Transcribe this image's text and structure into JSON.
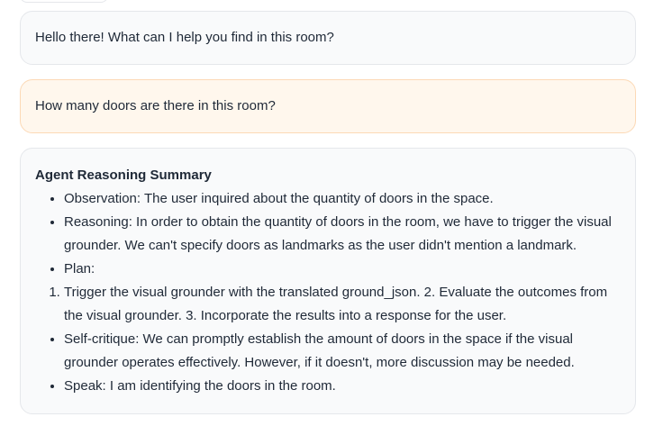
{
  "chat": {
    "greeting": "Hello there! What can I help you find in this room?",
    "user_question": "How many doors are there in this room?",
    "reasoning": {
      "title": "Agent Reasoning Summary",
      "bullets_a": [
        "Observation: The user inquired about the quantity of doors in the space.",
        "Reasoning: In order to obtain the quantity of doors in the room, we have to trigger the visual grounder. We can't specify doors as landmarks as the user didn't mention a landmark.",
        "Plan:"
      ],
      "plan_item": "Trigger the visual grounder with the translated ground_json. 2. Evaluate the outcomes from the visual grounder. 3. Incorporate the results into a response for the user.",
      "bullets_b": [
        "Self-critique: We can promptly establish the amount of doors in the space if the visual grounder operates effectively. However, if it doesn't, more discussion may be needed.",
        "Speak: I am identifying the doors in the room."
      ]
    }
  },
  "colors": {
    "bot_bubble_bg": "#f9fafb",
    "user_bubble_bg": "#fff7ed",
    "user_bubble_border": "#fcd9b6"
  }
}
